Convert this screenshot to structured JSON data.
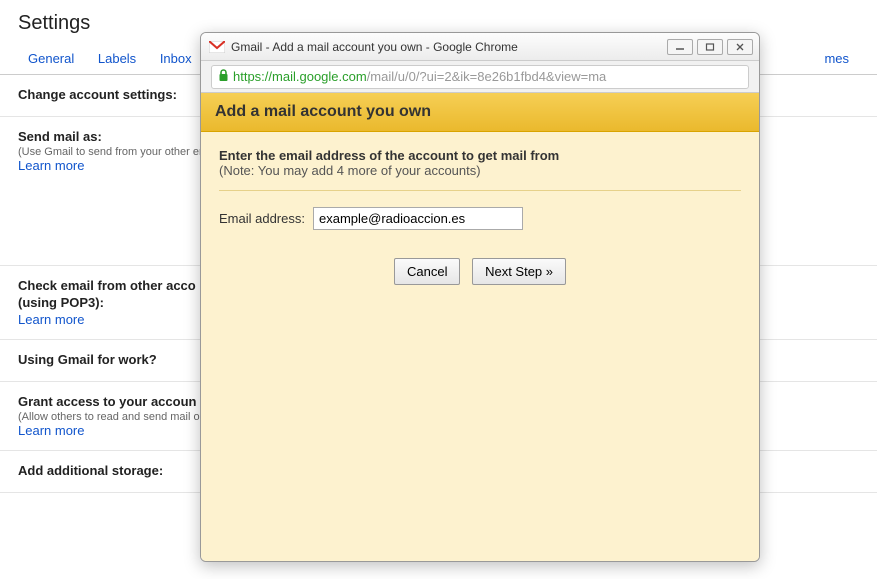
{
  "page": {
    "title": "Settings"
  },
  "tabs": {
    "general": "General",
    "labels": "Labels",
    "inbox": "Inbox",
    "themes_partial": "mes"
  },
  "sections": {
    "change_account": {
      "title": "Change account settings:"
    },
    "send_mail_as": {
      "title": "Send mail as:",
      "sub": "(Use Gmail to send from your other emai",
      "learn": "Learn more"
    },
    "check_email": {
      "title": "Check email from other acco",
      "sub": "(using POP3):",
      "learn": "Learn more"
    },
    "using_for_work": {
      "title": "Using Gmail for work?"
    },
    "grant_access": {
      "title": "Grant access to your accoun",
      "sub": "(Allow others to read and send mail on yo",
      "learn": "Learn more"
    },
    "storage": {
      "title": "Add additional storage:"
    }
  },
  "popup": {
    "window_title": "Gmail - Add a mail account you own - Google Chrome",
    "url": {
      "scheme": "https://",
      "host": "mail.google.com",
      "rest": "/mail/u/0/?ui=2&ik=8e26b1fbd4&view=ma"
    },
    "header": "Add a mail account you own",
    "form": {
      "prompt": "Enter the email address of the account to get mail from",
      "note": "(Note: You may add 4 more of your accounts)",
      "email_label": "Email address:",
      "email_value": "example@radioaccion.es",
      "cancel": "Cancel",
      "next": "Next Step »"
    }
  }
}
